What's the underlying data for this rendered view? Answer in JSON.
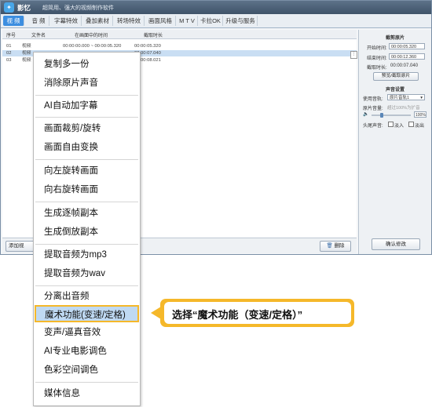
{
  "app": {
    "name": "影忆",
    "tagline": "超简用、强大的视频制作软件"
  },
  "menubar": {
    "tabs": [
      {
        "label": "视 频"
      },
      {
        "label": "音 频"
      },
      {
        "label": "字幕特效"
      },
      {
        "label": "叠加素材"
      },
      {
        "label": "转场特效"
      },
      {
        "label": "画面风格"
      },
      {
        "label": "M T V"
      },
      {
        "label": "卡拉OK"
      },
      {
        "label": "升级与服务"
      }
    ]
  },
  "table": {
    "headers": [
      "序号",
      "文件名",
      "在画面中的时间",
      "截取时长"
    ],
    "rows": [
      {
        "num": "01",
        "name": "视频",
        "time": "00:00:00.000 ~ 00:00:05.320",
        "duration": "00:00:05.320"
      },
      {
        "num": "02",
        "name": "视频",
        "time": "",
        "duration": "00:00:07.040"
      },
      {
        "num": "03",
        "name": "视频",
        "time": "",
        "duration": "00:00:08.021"
      }
    ],
    "row_button": "⋮"
  },
  "bottombar": {
    "add_label": "添加视",
    "delete_label": "删除"
  },
  "rightpanel": {
    "clip_title": "截剪原片",
    "start_label": "开始时间:",
    "start_value": "00:00:05.320",
    "end_label": "结束时间:",
    "end_value": "00:00:12.360",
    "duration_label": "截取时长:",
    "duration_value": "00:00:07.040",
    "preview_button": "预览/截取原片",
    "audio_title": "声音设置",
    "track_label": "使用音轨:",
    "track_value": "原片音轨1",
    "volume_label": "原片音量:",
    "volume_hint": "超过100%为扩音",
    "volume_value": "100%",
    "fade_label": "头尾声音:",
    "fade_in": "淡入",
    "fade_out": "淡出",
    "confirm_button": "确认修改"
  },
  "context_menu": {
    "items": [
      {
        "label": "复制多一份"
      },
      {
        "label": "消除原片声音"
      },
      {
        "label": "AI自动加字幕"
      },
      {
        "label": "画面裁剪/旋转"
      },
      {
        "label": "画面自由变换"
      },
      {
        "label": "向左旋转画面"
      },
      {
        "label": "向右旋转画面"
      },
      {
        "label": "生成逐帧副本"
      },
      {
        "label": "生成倒放副本"
      },
      {
        "label": "提取音频为mp3"
      },
      {
        "label": "提取音频为wav"
      },
      {
        "label": "分离出音频"
      },
      {
        "label": "魔术功能(变速/定格)"
      },
      {
        "label": "变声/逼真音效"
      },
      {
        "label": "AI专业电影调色"
      },
      {
        "label": "色彩空间调色"
      },
      {
        "label": "媒体信息"
      }
    ],
    "highlighted_index": 12
  },
  "callout": {
    "text": "选择“魔术功能（变速/定格）”",
    "color": "#f5b82a"
  },
  "colors": {
    "accent": "#3c8ee0",
    "highlight_border": "#f5b82a",
    "highlight_fill": "#bfd9f2"
  }
}
